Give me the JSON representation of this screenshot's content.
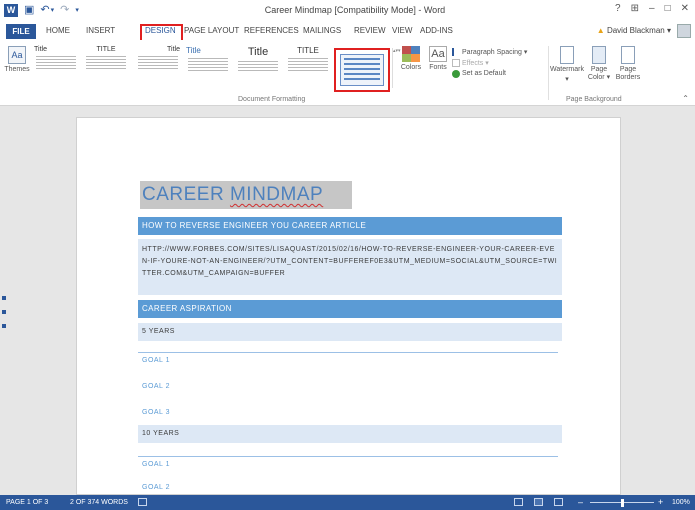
{
  "window": {
    "title": "Career Mindmap [Compatibility Mode] - Word",
    "help": "?",
    "ribbon_display": "⊞",
    "minimize": "–",
    "restore": "□",
    "close": "✕",
    "user": "David Blackman",
    "user_chevron": "▾",
    "qat_save": "▣",
    "qat_undo": "↶",
    "qat_undo_arrow": "▾",
    "qat_redo": "↷",
    "qat_customize": "▾",
    "logo_letter": "W"
  },
  "tabs": {
    "file": "FILE",
    "items": [
      "HOME",
      "INSERT",
      "DESIGN",
      "PAGE LAYOUT",
      "REFERENCES",
      "MAILINGS",
      "REVIEW",
      "VIEW",
      "ADD-INS"
    ],
    "active": "DESIGN"
  },
  "ribbon": {
    "themes_label": "Themes",
    "themes_icon_text": "Aa",
    "style_thumbs": [
      {
        "title": "Title"
      },
      {
        "title": "TITLE"
      },
      {
        "title": "Title"
      },
      {
        "title": "Title"
      },
      {
        "title": "Title"
      },
      {
        "title": "TITLE"
      }
    ],
    "gallery_arrows": "▴▾▾",
    "colors_label": "Colors",
    "fonts_label": "Fonts",
    "fonts_icon_text": "Aa",
    "paragraph_spacing": "Paragraph Spacing ▾",
    "effects": "Effects ▾",
    "set_as_default": "Set as Default",
    "document_formatting_label": "Document Formatting",
    "watermark_label": "Watermark",
    "watermark_chevron": "▾",
    "page_color_label": "Page Color ▾",
    "page_borders_label": "Page Borders",
    "page_background_label": "Page Background",
    "collapse": "⌃",
    "accent_colors": [
      "#c0504d",
      "#4f81bd",
      "#9bbb59",
      "#f79646"
    ]
  },
  "document": {
    "title_part1": "CAREER ",
    "title_part2": "MINDMAP",
    "heading1": "HOW TO REVERSE ENGINEER YOU CAREER ARTICLE",
    "url": "HTTP://WWW.FORBES.COM/SITES/LISAQUAST/2015/02/16/HOW-TO-REVERSE-ENGINEER-YOUR-CAREER-EVEN-IF-YOURE-NOT-AN-ENGINEER/?UTM_CONTENT=BUFFEREF0E3&UTM_MEDIUM=SOCIAL&UTM_SOURCE=TWITTER.COM&UTM_CAMPAIGN=BUFFER",
    "heading2": "CAREER ASPIRATION",
    "five_years": "5 YEARS",
    "goals_a": [
      "GOAL 1",
      "GOAL 2",
      "GOAL 3"
    ],
    "ten_years": "10 YEARS",
    "goals_b": [
      "GOAL 1",
      "GOAL 2"
    ]
  },
  "status": {
    "page": "PAGE 1 OF 3",
    "words": "2 OF 374 WORDS",
    "zoom_minus": "–",
    "zoom_plus": "+",
    "zoom": "100%",
    "zoom_level": 0.5
  }
}
